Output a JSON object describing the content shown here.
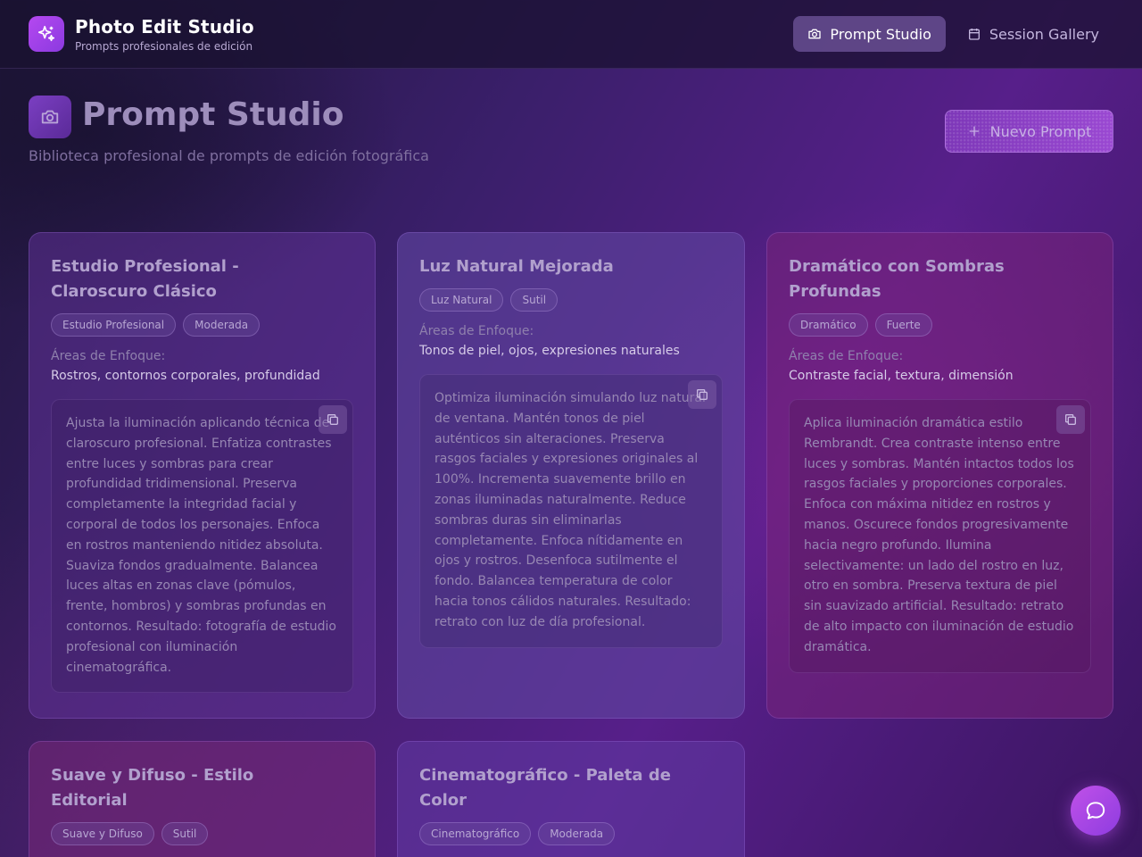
{
  "app": {
    "title": "Photo Edit Studio",
    "subtitle": "Prompts profesionales de edición",
    "logo_icon": "sparkles-icon"
  },
  "nav": {
    "items": [
      {
        "label": "Prompt Studio",
        "icon": "camera-icon",
        "active": true
      },
      {
        "label": "Session Gallery",
        "icon": "calendar-icon",
        "active": false
      }
    ]
  },
  "page": {
    "title": "Prompt Studio",
    "subtitle": "Biblioteca profesional de prompts de edición fotográfica",
    "new_button_label": "Nuevo Prompt"
  },
  "cards": [
    {
      "title": "Estudio Profesional - Claroscuro Clásico",
      "tags": [
        "Estudio Profesional",
        "Moderada"
      ],
      "focus_label": "Áreas de Enfoque:",
      "focus_value": "Rostros, contornos corporales, profundidad",
      "prompt": "Ajusta la iluminación aplicando técnica de claroscuro profesional. Enfatiza contrastes entre luces y sombras para crear profundidad tridimensional. Preserva completamente la integridad facial y corporal de todos los personajes. Enfoca en rostros manteniendo nitidez absoluta. Suaviza fondos gradualmente. Balancea luces altas en zonas clave (pómulos, frente, hombros) y sombras profundas en contornos. Resultado: fotografía de estudio profesional con iluminación cinematográfica."
    },
    {
      "title": "Luz Natural Mejorada",
      "tags": [
        "Luz Natural",
        "Sutil"
      ],
      "focus_label": "Áreas de Enfoque:",
      "focus_value": "Tonos de piel, ojos, expresiones naturales",
      "prompt": "Optimiza iluminación simulando luz natural de ventana. Mantén tonos de piel auténticos sin alteraciones. Preserva rasgos faciales y expresiones originales al 100%. Incrementa suavemente brillo en zonas iluminadas naturalmente. Reduce sombras duras sin eliminarlas completamente. Enfoca nítidamente en ojos y rostros. Desenfoca sutilmente el fondo. Balancea temperatura de color hacia tonos cálidos naturales. Resultado: retrato con luz de día profesional."
    },
    {
      "title": "Dramático con Sombras Profundas",
      "tags": [
        "Dramático",
        "Fuerte"
      ],
      "focus_label": "Áreas de Enfoque:",
      "focus_value": "Contraste facial, textura, dimensión",
      "prompt": "Aplica iluminación dramática estilo Rembrandt. Crea contraste intenso entre luces y sombras. Mantén intactos todos los rasgos faciales y proporciones corporales. Enfoca con máxima nitidez en rostros y manos. Oscurece fondos progresivamente hacia negro profundo. Ilumina selectivamente: un lado del rostro en luz, otro en sombra. Preserva textura de piel sin suavizado artificial. Resultado: retrato de alto impacto con iluminación de estudio dramática."
    },
    {
      "title": "Suave y Difuso - Estilo Editorial",
      "tags": [
        "Suave y Difuso",
        "Sutil"
      ]
    },
    {
      "title": "Cinematográfico - Paleta de Color",
      "tags": [
        "Cinematográfico",
        "Moderada"
      ]
    }
  ],
  "chat": {
    "icon": "chat-bubble-icon"
  }
}
